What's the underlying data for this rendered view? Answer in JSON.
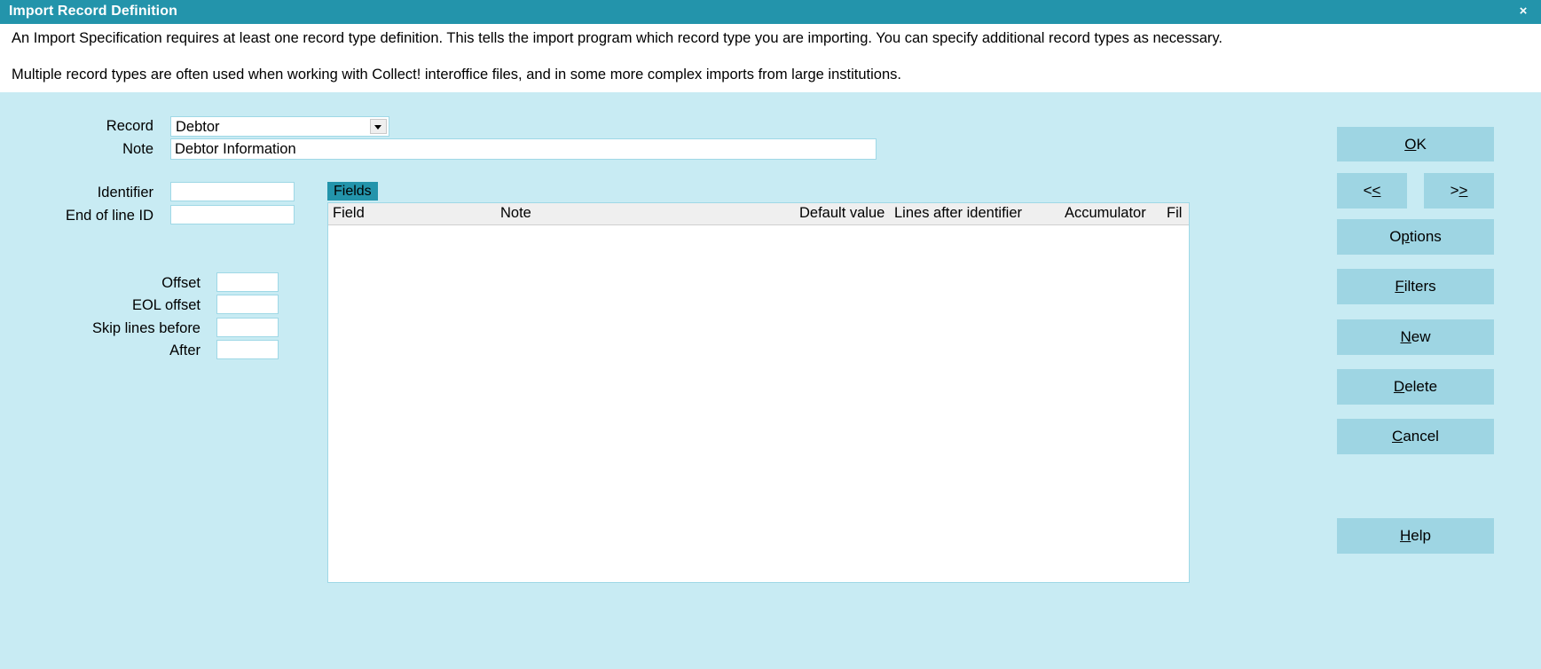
{
  "window": {
    "title": "Import Record Definition",
    "close_label": "×",
    "accent_color": "#2394ab",
    "body_color": "#c8ebf3",
    "button_color": "#9ed5e3"
  },
  "description": {
    "line1": "An Import Specification requires at least one record type definition. This tells the import program which record type you are importing. You can specify additional record types as necessary.",
    "line2": "Multiple record types are often used when working with Collect! interoffice files, and in some more complex imports from large institutions."
  },
  "form": {
    "record": {
      "label": "Record",
      "value": "Debtor",
      "options": [
        "Debtor"
      ]
    },
    "note": {
      "label": "Note",
      "value": "Debtor Information",
      "placeholder": ""
    },
    "identifier": {
      "label": "Identifier",
      "value": "",
      "placeholder": ""
    },
    "end_of_line_id": {
      "label": "End of line ID",
      "value": "",
      "placeholder": ""
    },
    "offset": {
      "label": "Offset",
      "value": "",
      "placeholder": ""
    },
    "eol_offset": {
      "label": "EOL offset",
      "value": "",
      "placeholder": ""
    },
    "skip_lines_before": {
      "label": "Skip lines before",
      "value": "",
      "placeholder": ""
    },
    "after": {
      "label": "After",
      "value": "",
      "placeholder": ""
    }
  },
  "fields_panel": {
    "tab_label": "Fields",
    "columns": [
      "Field",
      "Note",
      "Default value",
      "Lines after identifier",
      "Accumulator",
      "Fil"
    ],
    "rows": []
  },
  "buttons": {
    "ok": {
      "pre": "",
      "acc": "O",
      "post": "K"
    },
    "prev": {
      "pre": "<",
      "acc": "<",
      "post": ""
    },
    "next": {
      "pre": ">",
      "acc": ">",
      "post": ""
    },
    "options": {
      "pre": "O",
      "acc": "p",
      "post": "tions"
    },
    "filters": {
      "pre": "",
      "acc": "F",
      "post": "ilters"
    },
    "new": {
      "pre": "",
      "acc": "N",
      "post": "ew"
    },
    "delete": {
      "pre": "",
      "acc": "D",
      "post": "elete"
    },
    "cancel": {
      "pre": "",
      "acc": "C",
      "post": "ancel"
    },
    "help": {
      "pre": "",
      "acc": "H",
      "post": "elp"
    }
  }
}
